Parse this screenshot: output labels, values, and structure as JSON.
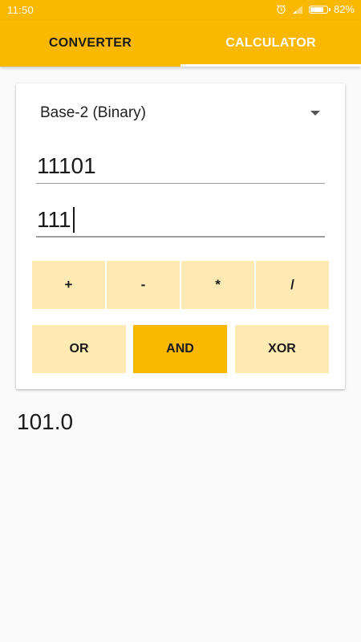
{
  "status_bar": {
    "time": "11:50",
    "battery_percent": "82%",
    "battery_level": 0.82,
    "icons": [
      "alarm-icon",
      "signal-icon",
      "battery-icon"
    ]
  },
  "tabs": [
    {
      "label": "CONVERTER",
      "active": true
    },
    {
      "label": "CALCULATOR",
      "active": false
    }
  ],
  "calculator": {
    "base_select": "Base-2 (Binary)",
    "first_operand": "11101",
    "second_operand": "111",
    "operations": [
      "+",
      "-",
      "*",
      "/"
    ],
    "logic_operations": [
      "OR",
      "AND",
      "XOR"
    ],
    "selected_logic": "AND",
    "result": "101.0"
  },
  "colors": {
    "accent": "#fbb800",
    "button_light": "#ffeab4",
    "background": "#fafafa"
  }
}
